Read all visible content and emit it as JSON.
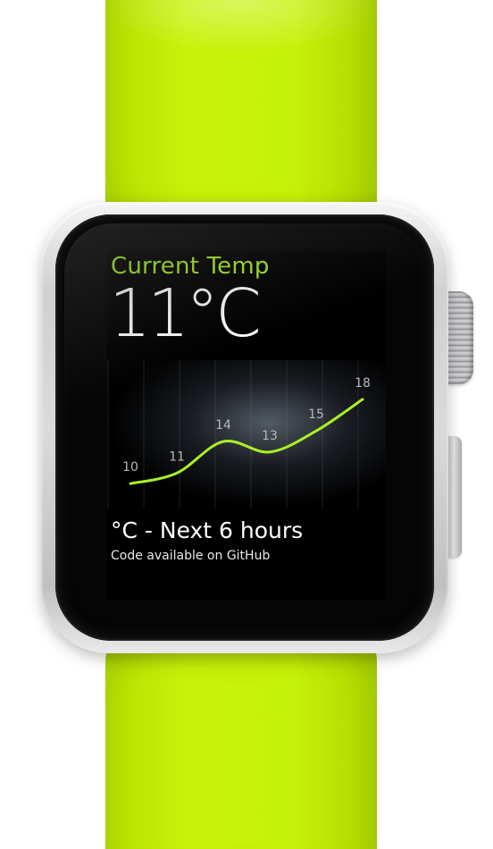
{
  "app": {
    "title": "Current Temp",
    "current_temp": "11°C",
    "chart_label": "°C - Next 6 hours",
    "caption": "Code available on GitHub",
    "accent_color": "#a9ee2a",
    "band_color": "#c4ee08"
  },
  "chart_data": {
    "type": "line",
    "title": "",
    "xlabel": "",
    "ylabel": "",
    "x": [
      1,
      2,
      3,
      4,
      5,
      6
    ],
    "series": [
      {
        "values": [
          10,
          11,
          14,
          13,
          15,
          18
        ]
      }
    ],
    "data_labels": [
      "10",
      "11",
      "14",
      "13",
      "15",
      "18"
    ],
    "ylim": [
      9,
      19
    ],
    "grid": false,
    "line_color": "#a9ee2a"
  }
}
